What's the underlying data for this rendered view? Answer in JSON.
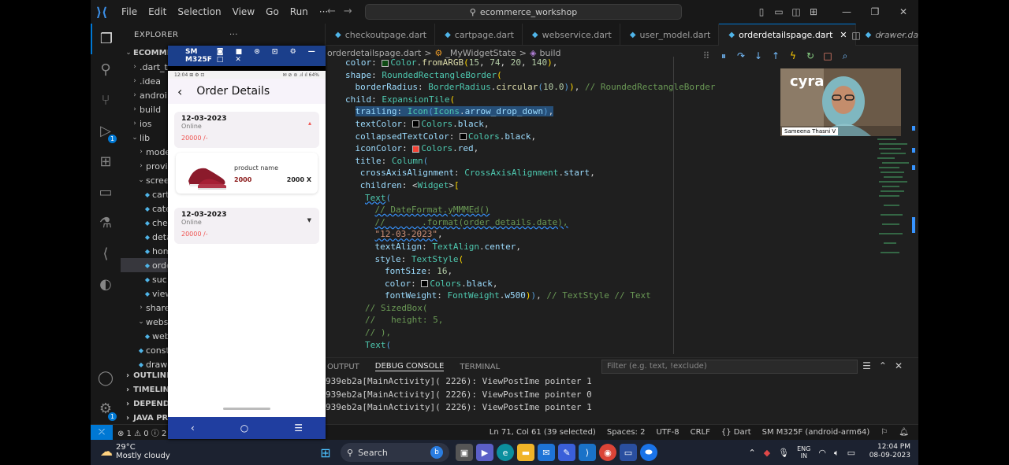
{
  "window": {
    "menu": [
      "File",
      "Edit",
      "Selection",
      "View",
      "Go",
      "Run",
      "···"
    ],
    "search_text": "ecommerce_workshop"
  },
  "explorer": {
    "title": "EXPLORER",
    "root": "ECOMMER",
    "items": [
      {
        "label": ".dart_to",
        "indent": 1,
        "type": "folder",
        "expanded": false
      },
      {
        "label": ".idea",
        "indent": 1,
        "type": "folder",
        "expanded": false
      },
      {
        "label": "androi",
        "indent": 1,
        "type": "folder",
        "expanded": false
      },
      {
        "label": "build",
        "indent": 1,
        "type": "folder",
        "expanded": false
      },
      {
        "label": "ios",
        "indent": 1,
        "type": "folder",
        "expanded": false
      },
      {
        "label": "lib",
        "indent": 1,
        "type": "folder",
        "expanded": true
      },
      {
        "label": "mode",
        "indent": 2,
        "type": "folder",
        "expanded": false
      },
      {
        "label": "provi",
        "indent": 2,
        "type": "folder",
        "expanded": false
      },
      {
        "label": "scree",
        "indent": 2,
        "type": "folder",
        "expanded": true
      },
      {
        "label": "cart",
        "indent": 3,
        "type": "file"
      },
      {
        "label": "cate",
        "indent": 3,
        "type": "file"
      },
      {
        "label": "che",
        "indent": 3,
        "type": "file"
      },
      {
        "label": "deta",
        "indent": 3,
        "type": "file"
      },
      {
        "label": "hom",
        "indent": 3,
        "type": "file"
      },
      {
        "label": "orde",
        "indent": 3,
        "type": "file",
        "selected": true
      },
      {
        "label": "suc",
        "indent": 3,
        "type": "file"
      },
      {
        "label": "view",
        "indent": 3,
        "type": "file"
      },
      {
        "label": "share",
        "indent": 2,
        "type": "folder",
        "expanded": false
      },
      {
        "label": "webs",
        "indent": 2,
        "type": "folder",
        "expanded": true
      },
      {
        "label": "web",
        "indent": 3,
        "type": "file"
      },
      {
        "label": "const",
        "indent": 2,
        "type": "file"
      },
      {
        "label": "drawe",
        "indent": 2,
        "type": "file"
      }
    ],
    "sections": [
      "OUTLINE",
      "TIMELINE",
      "DEPENDEN",
      "JAVA PRO"
    ]
  },
  "tabs": [
    {
      "label": "checkoutpage.dart",
      "active": false,
      "italic": false
    },
    {
      "label": "cartpage.dart",
      "active": false,
      "italic": false
    },
    {
      "label": "webservice.dart",
      "active": false,
      "italic": false
    },
    {
      "label": "user_model.dart",
      "active": false,
      "italic": false
    },
    {
      "label": "orderdetailspage.dart",
      "active": true,
      "italic": false
    },
    {
      "label": "drawer.dart",
      "active": false,
      "italic": true
    }
  ],
  "breadcrumb": [
    "orderdetailspage.dart",
    ">",
    "_MyWidgetState",
    ">",
    "build"
  ],
  "code": [
    {
      "indent": 4,
      "html": "<span class='k'>color</span><span class='w'>: </span><span class='sw' style='background:#0f4a14'></span><span class='c'>Color</span><span class='w'>.</span><span class='f'>fromARGB</span><span class='p'>(</span><span class='n'>15</span><span class='w'>, </span><span class='n'>74</span><span class='w'>, </span><span class='n'>20</span><span class='w'>, </span><span class='n'>140</span><span class='p'>)</span><span class='w'>,</span>"
    },
    {
      "indent": 4,
      "html": "<span class='k'>shape</span><span class='w'>: </span><span class='c'>RoundedRectangleBorder</span><span class='p'>(</span>"
    },
    {
      "indent": 6,
      "html": "<span class='k'>borderRadius</span><span class='w'>: </span><span class='c'>BorderRadius</span><span class='w'>.</span><span class='f'>circular</span><span class='b'>(</span><span class='n'>10.0</span><span class='b'>)</span><span class='p'>)</span><span class='w'>, </span><span class='cm'>// RoundedRectangleBorder</span>"
    },
    {
      "indent": 4,
      "html": "<span class='k'>child</span><span class='w'>: </span><span class='c'>ExpansionTile</span><span class='p'>(</span>"
    },
    {
      "indent": 6,
      "hl": true,
      "html": "<span class='hlb'><span class='k'>trailing</span><span class='w'>: </span><span class='c'>Icon</span><span class='b'>(</span><span class='c'>Icons</span><span class='w'>.</span><span class='k'>arrow_drop_down</span><span class='b'>)</span><span class='w'>,</span></span>"
    },
    {
      "indent": 6,
      "html": "<span class='k'>textColor</span><span class='w'>: </span><span class='sw' style='background:#000'></span><span class='c'>Colors</span><span class='w'>.</span><span class='k'>black</span><span class='w'>,</span>"
    },
    {
      "indent": 6,
      "html": "<span class='k'>collapsedTextColor</span><span class='w'>: </span><span class='sw' style='background:#000'></span><span class='c'>Colors</span><span class='w'>.</span><span class='k'>black</span><span class='w'>,</span>"
    },
    {
      "indent": 6,
      "html": "<span class='k'>iconColor</span><span class='w'>: </span><span class='sw' style='background:#f44336'></span><span class='c'>Colors</span><span class='w'>.</span><span class='k'>red</span><span class='w'>,</span>"
    },
    {
      "indent": 6,
      "html": "<span class='k'>title</span><span class='w'>: </span><span class='c'>Column</span><span class='b'>(</span>"
    },
    {
      "indent": 7,
      "html": "<span class='k'>crossAxisAlignment</span><span class='w'>: </span><span class='c'>CrossAxisAlignment</span><span class='w'>.</span><span class='k'>start</span><span class='w'>,</span>"
    },
    {
      "indent": 7,
      "html": "<span class='k'>children</span><span class='w'>: &lt;</span><span class='c'>Widget</span><span class='w'>&gt;</span><span class='p'>[</span>"
    },
    {
      "indent": 8,
      "html": "<span class='c sq'>Text</span><span class='b'>(</span>"
    },
    {
      "indent": 10,
      "html": "<span class='cm sq'>// DateFormat.yMMMEd()</span>"
    },
    {
      "indent": 10,
      "html": "<span class='cm sq'>//       .format(order_details.date),</span>"
    },
    {
      "indent": 10,
      "html": "<span class='s sq'>\"12-03-2023\"</span><span class='w'>,</span>"
    },
    {
      "indent": 10,
      "html": "<span class='k'>textAlign</span><span class='w'>: </span><span class='c'>TextAlign</span><span class='w'>.</span><span class='k'>center</span><span class='w'>,</span>"
    },
    {
      "indent": 10,
      "html": "<span class='k'>style</span><span class='w'>: </span><span class='c'>TextStyle</span><span class='p'>(</span>"
    },
    {
      "indent": 12,
      "html": "<span class='k'>fontSize</span><span class='w'>: </span><span class='n'>16</span><span class='w'>,</span>"
    },
    {
      "indent": 12,
      "html": "<span class='k'>color</span><span class='w'>: </span><span class='sw' style='background:#000'></span><span class='c'>Colors</span><span class='w'>.</span><span class='k'>black</span><span class='w'>,</span>"
    },
    {
      "indent": 12,
      "html": "<span class='k'>fontWeight</span><span class='w'>: </span><span class='c'>FontWeight</span><span class='w'>.</span><span class='k'>w500</span><span class='p'>)</span><span class='b'>)</span><span class='w'>, </span><span class='cm'>// TextStyle // Text</span>"
    },
    {
      "indent": 8,
      "html": "<span class='cm'>// SizedBox(</span>"
    },
    {
      "indent": 8,
      "html": "<span class='cm'>//   height: 5,</span>"
    },
    {
      "indent": 8,
      "html": "<span class='cm'>// ),</span>"
    },
    {
      "indent": 8,
      "html": "<span class='c'>Text</span><span class='b'>(</span>"
    }
  ],
  "panel": {
    "tabs": [
      "OUTPUT",
      "DEBUG CONSOLE",
      "TERMINAL"
    ],
    "active_tab": "DEBUG CONSOLE",
    "filter_placeholder": "Filter (e.g. text, !exclude)",
    "lines": [
      "939eb2a[MainActivity]( 2226): ViewPostIme pointer 1",
      "939eb2a[MainActivity]( 2226): ViewPostIme pointer 0",
      "939eb2a[MainActivity]( 2226): ViewPostIme pointer 1"
    ]
  },
  "status": {
    "errors": "⊗ 1 ⚠ 0 ⓘ 2",
    "position": "Ln 71, Col 61 (39 selected)",
    "spaces": "Spaces: 2",
    "encoding": "UTF-8",
    "eol": "CRLF",
    "language": "{} Dart",
    "device": "SM M325F (android-arm64)"
  },
  "phone": {
    "window_title": "SM M325F",
    "status_time": "12:04 ⊞ ⚙ ⊡",
    "status_right": "✉ ⊘ ⊜ .ıl ıl 64%",
    "app_title": "Order Details",
    "orders": [
      {
        "date": "12-03-2023",
        "mode": "Online",
        "price": "20000 /-"
      },
      {
        "date": "12-03-2023",
        "mode": "Online",
        "price": "20000 /-"
      }
    ],
    "product": {
      "name": "product name",
      "price": "2000",
      "qty": "2000 X"
    }
  },
  "webcam": {
    "brand": "cyra",
    "name": "Sameena Thasni V"
  },
  "taskbar": {
    "temp": "29°C",
    "weather": "Mostly cloudy",
    "search": "Search",
    "lang": "ENG",
    "region": "IN",
    "time": "12:04 PM",
    "date": "08-09-2023"
  },
  "colors": {
    "accent": "#0078d4",
    "phone_nav": "#203ea0",
    "price_red": "#ef5350"
  }
}
